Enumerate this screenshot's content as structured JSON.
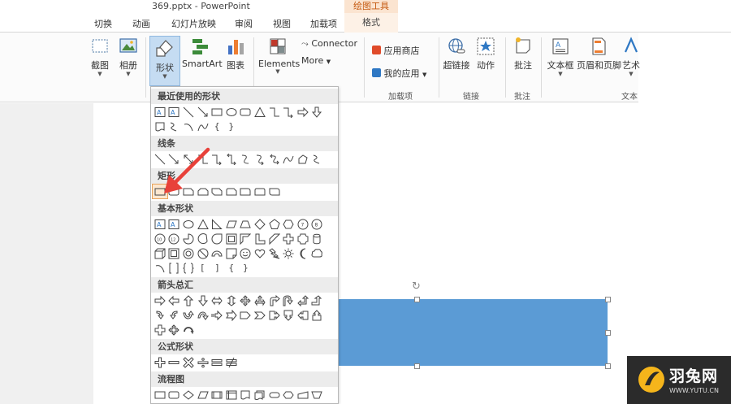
{
  "window": {
    "title": "369.pptx - PowerPoint",
    "context_tab_group": "绘图工具"
  },
  "tabs": [
    {
      "label": "切换"
    },
    {
      "label": "动画"
    },
    {
      "label": "幻灯片放映"
    },
    {
      "label": "审阅"
    },
    {
      "label": "视图"
    },
    {
      "label": "加载项"
    },
    {
      "label": "格式"
    }
  ],
  "ribbon": {
    "screenshot_label": "截图",
    "album_label": "相册",
    "shapes_label": "形状",
    "smartart_label": "SmartArt",
    "chart_label": "图表",
    "elements_label": "Elements",
    "connector_label": "Connector",
    "more_label": "More",
    "app_store_label": "应用商店",
    "my_apps_label": "我的应用",
    "hyperlink_label": "超链接",
    "action_label": "动作",
    "comment_label": "批注",
    "textbox_label": "文本框",
    "header_footer_label": "页眉和页脚",
    "wordart_label": "艺术",
    "groups": {
      "addins": "加载项",
      "links": "链接",
      "comments": "批注",
      "text": "文本"
    },
    "colors": {
      "shapes_active_bg": "#c5dcf2",
      "context_tab": "#c55a11"
    }
  },
  "shapes_menu": {
    "sections": [
      {
        "title": "最近使用的形状"
      },
      {
        "title": "线条"
      },
      {
        "title": "矩形"
      },
      {
        "title": "基本形状"
      },
      {
        "title": "箭头总汇"
      },
      {
        "title": "公式形状"
      },
      {
        "title": "流程图"
      }
    ],
    "text_glyphs": {
      "brace_open": "{",
      "brace_close": "}",
      "bracket_open": "[",
      "bracket_close": "]"
    }
  },
  "slide": {
    "selected_shape_color": "#5b9bd5"
  },
  "watermark": {
    "name": "羽兔网",
    "url": "WWW.YUTU.CN"
  }
}
